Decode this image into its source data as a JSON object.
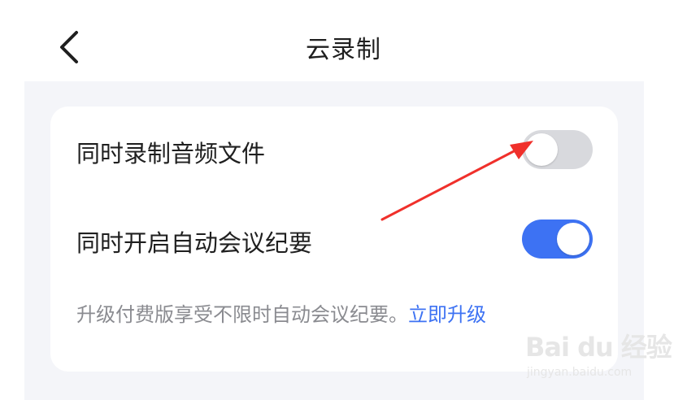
{
  "header": {
    "title": "云录制",
    "back_icon": "chevron-left-icon"
  },
  "settings": [
    {
      "label": "同时录制音频文件",
      "toggle_on": false
    },
    {
      "label": "同时开启自动会议纪要",
      "toggle_on": true
    }
  ],
  "hint": {
    "text": "升级付费版享受不限时自动会议纪要。",
    "link": "立即升级"
  },
  "annotation": {
    "type": "arrow",
    "color": "#f0302b",
    "points_to": "同时录制音频文件"
  },
  "watermark": {
    "brand": "Bai du 经验",
    "domain": "jingyan.baidu.com"
  },
  "colors": {
    "accent": "#3d72f3",
    "toggle_off": "#d8d9dd",
    "panel_bg": "#f4f5f9",
    "arrow": "#f0302b"
  }
}
